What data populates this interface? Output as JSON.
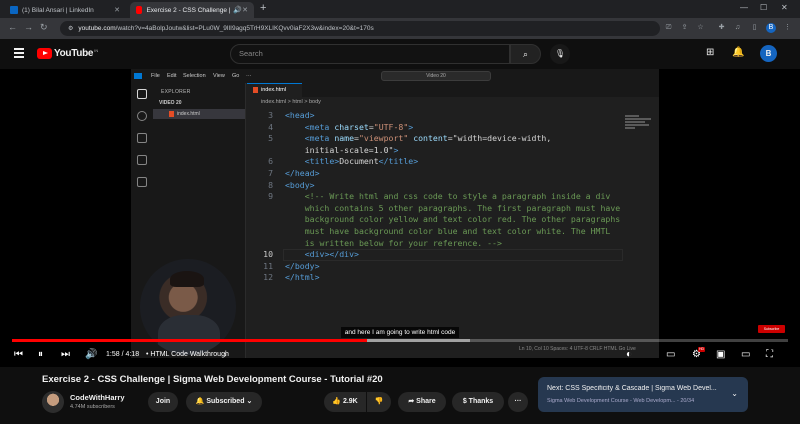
{
  "browser": {
    "tabs": [
      {
        "label": "(1) Bilal Ansari | LinkedIn"
      },
      {
        "label": "Exercise 2 - CSS Challenge | Sigma"
      }
    ],
    "url_host": "youtube.com",
    "url_path": "/watch?v=4aBolpJoutw&list=PLu0W_9lII9agq5TrH9XLIKQvv0iaF2X3w&index=20&t=170s"
  },
  "youtube": {
    "logo_text": "YouTube",
    "region": "IN",
    "search_placeholder": "Search",
    "avatar_letter": "B"
  },
  "vscode": {
    "menu": [
      "File",
      "Edit",
      "Selection",
      "View",
      "Go",
      "···"
    ],
    "command_center": "Video 20",
    "explorer_header": "EXPLORER",
    "folder": "VIDEO 20",
    "file": "index.html",
    "tab": "index.html",
    "breadcrumb": "index.html > html > body",
    "status": "Ln 10, Col 10   Spaces: 4   UTF-8   CRLF   HTML   Go Live"
  },
  "code_lines": [
    {
      "n": "3",
      "text": "<head>"
    },
    {
      "n": "4",
      "text": "    <meta charset=\"UTF-8\">"
    },
    {
      "n": "5",
      "text": "    <meta name=\"viewport\" content=\"width=device-width,"
    },
    {
      "n": "",
      "text": "    initial-scale=1.0\">"
    },
    {
      "n": "6",
      "text": "    <title>Document</title>"
    },
    {
      "n": "7",
      "text": "</head>"
    },
    {
      "n": "8",
      "text": "<body>"
    },
    {
      "n": "9",
      "text": "    <!-- Write html and css code to style a paragraph inside a div"
    },
    {
      "n": "",
      "text": "    which contains 5 other paragraphs. The first paragraph must have"
    },
    {
      "n": "",
      "text": "    background color yellow and text color red. The other paragraphs"
    },
    {
      "n": "",
      "text": "    must have background color blue and text color white. The HMTL"
    },
    {
      "n": "",
      "text": "    is written below for your reference. -->"
    },
    {
      "n": "10",
      "text": "    <div></div>"
    },
    {
      "n": "11",
      "text": "</body>"
    },
    {
      "n": "12",
      "text": "</html>"
    }
  ],
  "player": {
    "caption": "and here I am going to write html code",
    "time": "1:58 / 4:18",
    "chapter": "• HTML Code Walkthrough",
    "progress_played": 0.457,
    "progress_buffered": 0.59,
    "subscribe_badge": "Subscribe",
    "hd_badge": "HD"
  },
  "video": {
    "title": "Exercise 2 - CSS Challenge | Sigma Web Development Course - Tutorial #20",
    "channel": "CodeWithHarry",
    "subscribers": "4.74M subscribers",
    "join": "Join",
    "subscribed": "Subscribed",
    "likes": "2.9K",
    "share": "Share",
    "thanks": "Thanks",
    "next_title": "Next: CSS Specificity & Cascade | Sigma Web Devel...",
    "next_subtitle": "Sigma Web Development Course - Web Developm... - 20/34"
  }
}
